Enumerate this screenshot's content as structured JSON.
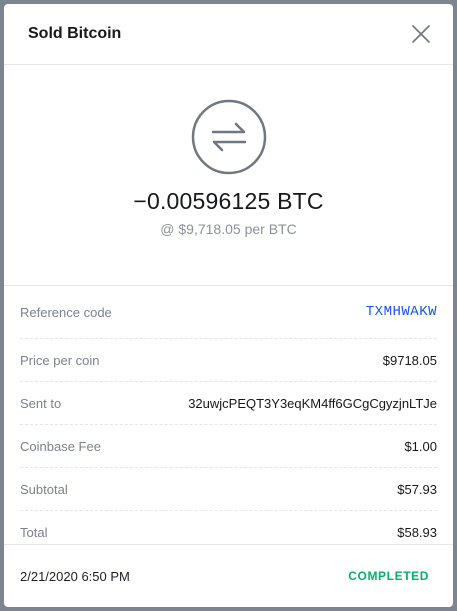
{
  "header": {
    "title": "Sold Bitcoin"
  },
  "hero": {
    "icon": "swap-arrows-icon",
    "amount": "−0.00596125 BTC",
    "rate": "@ $9,718.05 per BTC"
  },
  "details": [
    {
      "label": "Reference code",
      "value": "TXMHWAKW"
    },
    {
      "label": "Price per coin",
      "value": "$9718.05"
    },
    {
      "label": "Sent to",
      "value": "32uwjcPEQT3Y3eqKM4ff6GCgCgyzjnLTJe"
    },
    {
      "label": "Coinbase Fee",
      "value": "$1.00"
    },
    {
      "label": "Subtotal",
      "value": "$57.93"
    },
    {
      "label": "Total",
      "value": "$58.93"
    }
  ],
  "footer": {
    "timestamp": "2/21/2020 6:50 PM",
    "status": "COMPLETED"
  },
  "colors": {
    "accent_link": "#1652f0",
    "status_completed": "#05b169",
    "icon_gray": "#8a919a"
  }
}
